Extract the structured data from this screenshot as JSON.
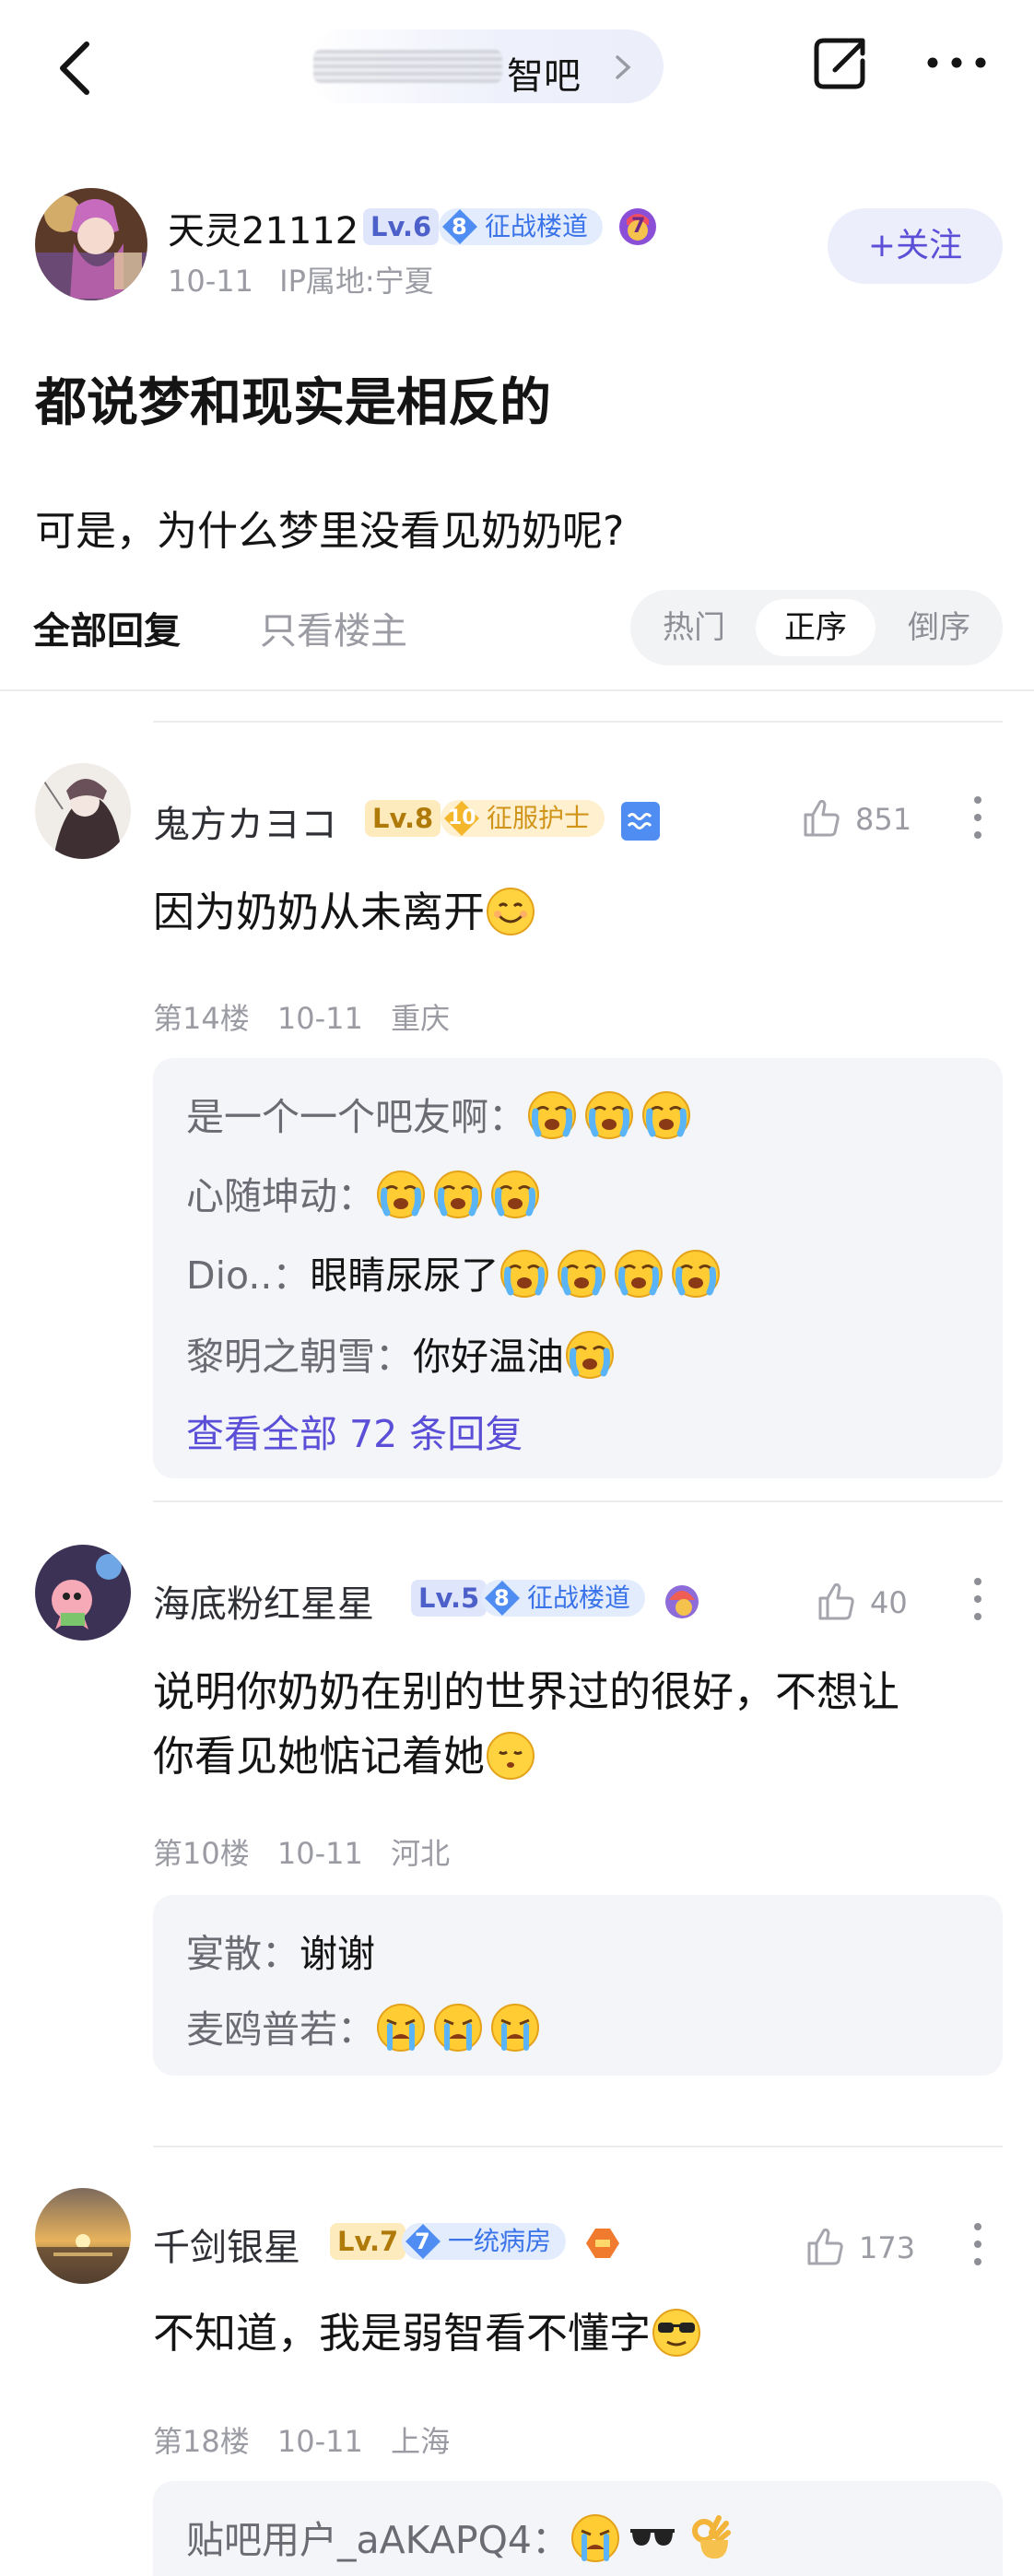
{
  "nav": {
    "forum_name": "智吧"
  },
  "post": {
    "author": {
      "name": "天灵21112",
      "level": "Lv.6",
      "badge_num": "8",
      "badge": "征战楼道",
      "medal_num": "7",
      "date": "10-11",
      "ip": "IP属地:宁夏"
    },
    "follow_label": "+关注",
    "title": "都说梦和现实是相反的",
    "body": "可是，为什么梦里没看见奶奶呢?"
  },
  "tabs": {
    "all": "全部回复",
    "op_only": "只看楼主"
  },
  "sort": {
    "hot": "热门",
    "asc": "正序",
    "desc": "倒序",
    "selected": "正序"
  },
  "replies": [
    {
      "user": "鬼方カヨコ",
      "level": "Lv.8",
      "badge_num": "10",
      "badge": "征服护士",
      "likes": "851",
      "text": "因为奶奶从未离开",
      "floor": "第14楼",
      "date": "10-11",
      "location": "重庆",
      "subreplies": [
        {
          "who": "是一个一个吧友啊：",
          "text": ""
        },
        {
          "who": "心随坤动：",
          "text": ""
        },
        {
          "who": "Dio..：",
          "text": "眼睛尿尿了"
        },
        {
          "who": "黎明之朝雪：",
          "text": "你好温油"
        }
      ],
      "view_all": "查看全部 72 条回复"
    },
    {
      "user": "海底粉红星星",
      "level": "Lv.5",
      "badge_num": "8",
      "badge": "征战楼道",
      "likes": "40",
      "text_line1": "说明你奶奶在别的世界过的很好，不想让",
      "text_line2": "你看见她惦记着她",
      "floor": "第10楼",
      "date": "10-11",
      "location": "河北",
      "subreplies": [
        {
          "who": "宴散：",
          "text": "谢谢"
        },
        {
          "who": "麦鸥普若：",
          "text": ""
        }
      ]
    },
    {
      "user": "千剑银星",
      "level": "Lv.7",
      "badge_num": "7",
      "badge": "一统病房",
      "likes": "173",
      "text": "不知道，我是弱智看不懂字",
      "floor": "第18楼",
      "date": "10-11",
      "location": "上海",
      "subreplies": [
        {
          "who": "贴吧用户_aAKAPQ4：",
          "text": ""
        }
      ]
    }
  ]
}
